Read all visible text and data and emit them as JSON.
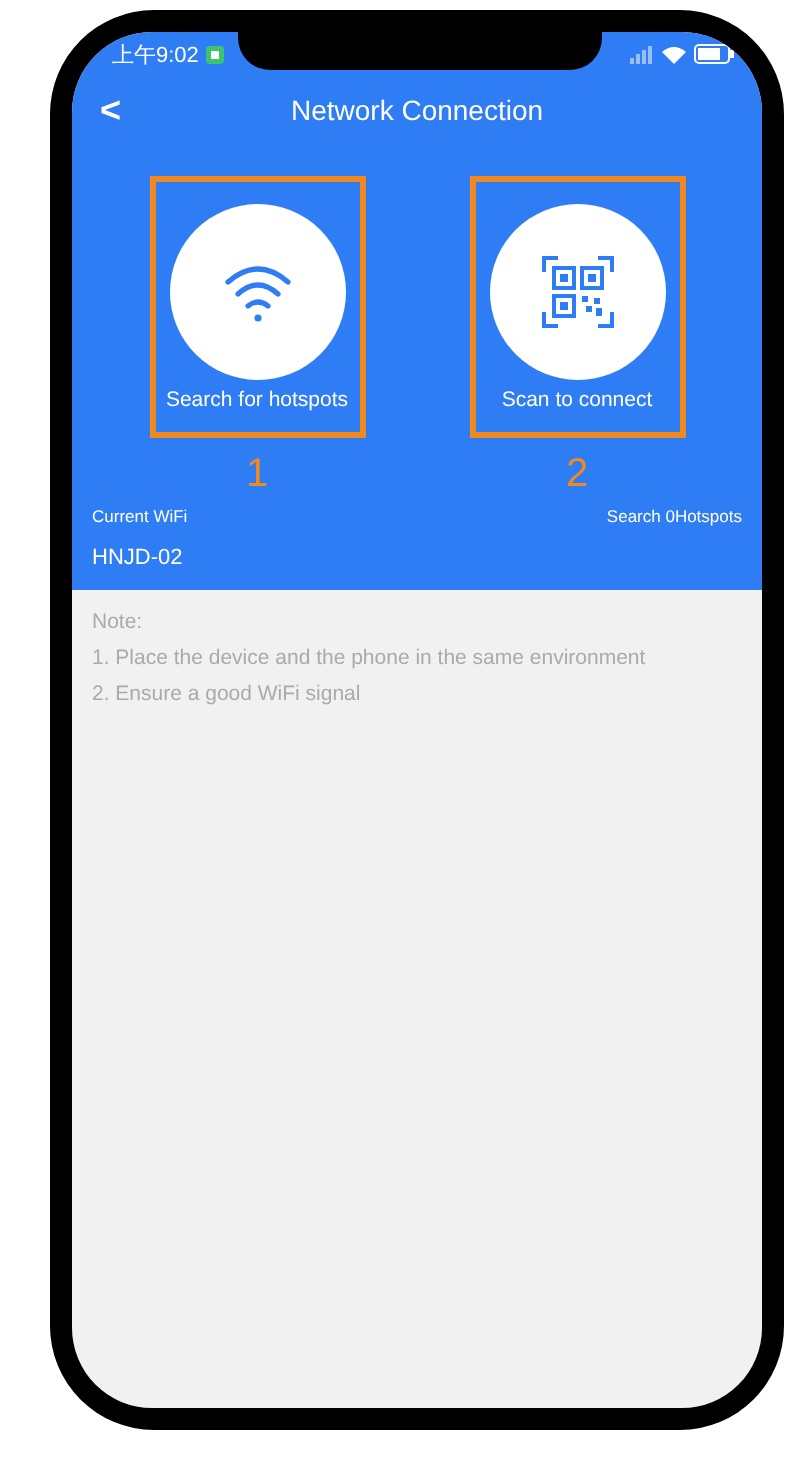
{
  "status_bar": {
    "time": "上午9:02"
  },
  "header": {
    "back": "<",
    "title": "Network Connection"
  },
  "options": [
    {
      "kind": "wifi",
      "label": "Search for hotspots",
      "marker": "1"
    },
    {
      "kind": "qr",
      "label": "Scan to connect",
      "marker": "2"
    }
  ],
  "wifi_info": {
    "current_label": "Current WiFi",
    "search_label": "Search 0Hotspots",
    "network": "HNJD-02"
  },
  "notes": {
    "heading": "Note:",
    "items": [
      "1. Place the device and the phone in the same environment",
      "2. Ensure a good WiFi signal"
    ]
  }
}
